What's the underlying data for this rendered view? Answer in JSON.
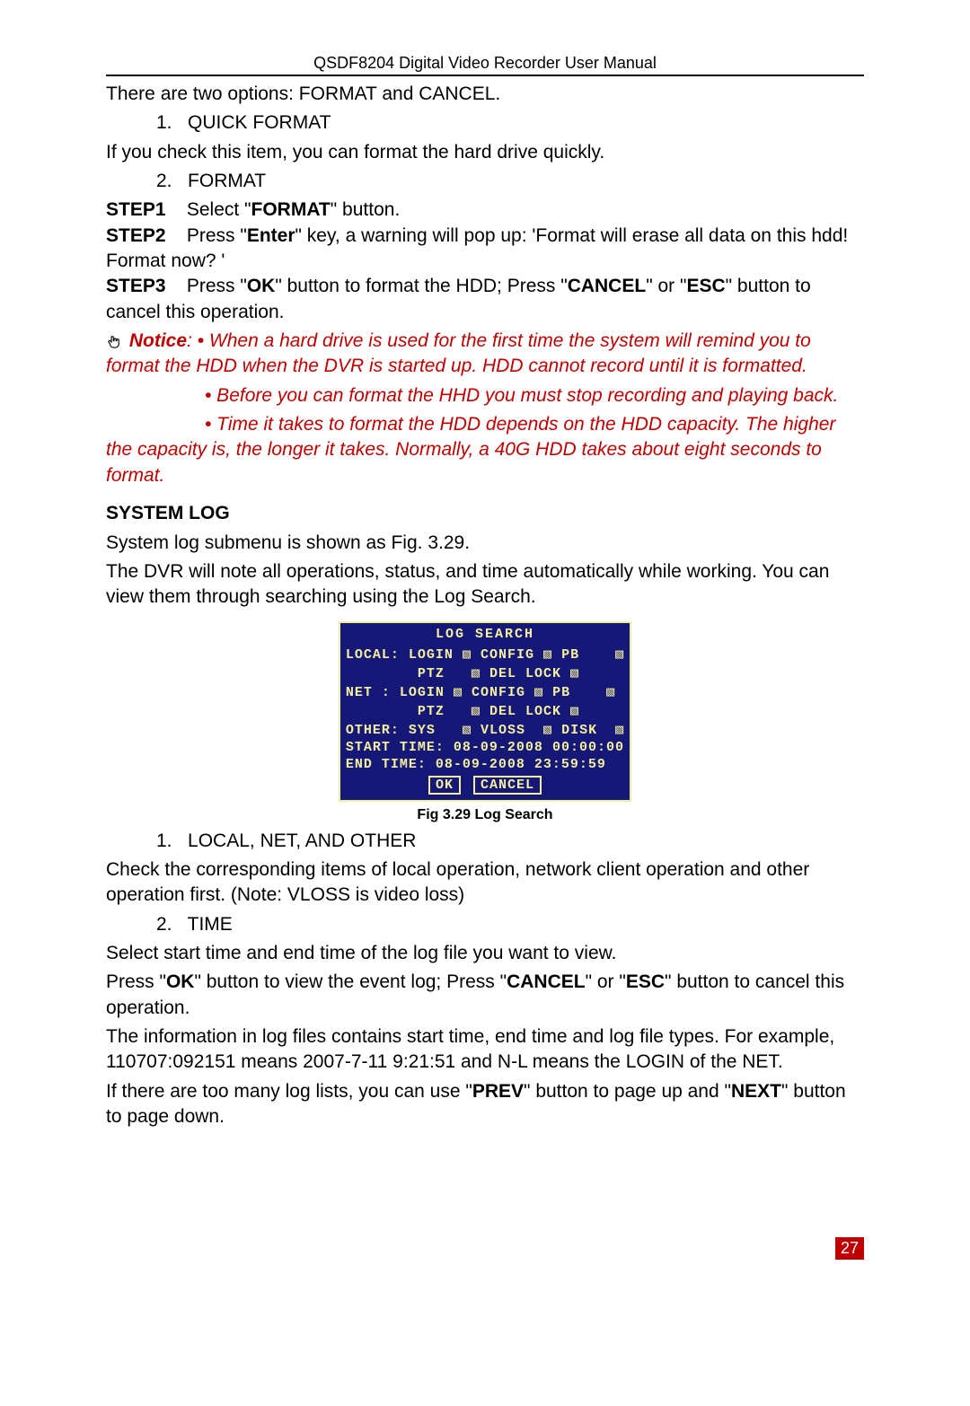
{
  "header": "QSDF8204 Digital Video Recorder User Manual",
  "intro": "There are two options: FORMAT and CANCEL.",
  "item1_num": "1.",
  "item1_label": "QUICK FORMAT",
  "item1_desc": "If you check this item, you can format the hard drive quickly.",
  "item2_num": "2.",
  "item2_label": "FORMAT",
  "step1_lbl": "STEP1",
  "step1_a": "Select \"",
  "step1_bold": "FORMAT",
  "step1_b": "\" button.",
  "step2_lbl": "STEP2",
  "step2_a": "Press \"",
  "step2_bold": "Enter",
  "step2_b": "\" key, a warning will pop up: 'Format will erase all data on this hdd!   Format now? '",
  "step3_lbl": "STEP3",
  "step3_a": "Press \"",
  "step3_bold1": "OK",
  "step3_b": "\" button to format the HDD; Press \"",
  "step3_bold2": "CANCEL",
  "step3_c": "\" or \"",
  "step3_bold3": "ESC",
  "step3_d": "\" button to cancel this operation.",
  "notice_label": "Notice",
  "notice_line1": ": • When a hard drive is used for the first time the system will remind you to format the HDD when the DVR is started up. HDD cannot record until it is formatted.",
  "notice_line2": "• Before you can format the HHD you must stop recording and playing back.",
  "notice_line3": "• Time it takes to format the HDD depends on the HDD capacity. The higher the capacity is, the longer it takes. Normally, a 40G HDD takes about eight seconds to format.",
  "syslog_heading": "SYSTEM LOG",
  "syslog_p1": "System log submenu is shown as Fig. 3.29.",
  "syslog_p2": "The DVR will note all operations, status, and time automatically while working. You can view them through searching using the Log Search.",
  "dvr": {
    "title": "LOG SEARCH",
    "row1": {
      "label": "LOCAL:",
      "c1": "LOGIN",
      "c2": "CONFIG",
      "c3": "PB"
    },
    "row2": {
      "label": "",
      "c1": "PTZ",
      "c2": "DEL LOCK"
    },
    "row3": {
      "label": "NET  :",
      "c1": "LOGIN",
      "c2": "CONFIG",
      "c3": "PB"
    },
    "row4": {
      "label": "",
      "c1": "PTZ",
      "c2": "DEL LOCK"
    },
    "row5": {
      "label": "OTHER:",
      "c1": "SYS",
      "c2": "VLOSS",
      "c3": "DISK"
    },
    "start_label": "START TIME:",
    "start_value": "08-09-2008 00:00:00",
    "end_label": "END   TIME:",
    "end_value": "08-09-2008 23:59:59",
    "ok": "OK",
    "cancel": "CANCEL"
  },
  "fig_caption": "Fig 3.29 Log Search",
  "log_item1_num": "1.",
  "log_item1_label": "LOCAL, NET, AND OTHER",
  "log_item1_desc": "Check the corresponding items of local operation, network client operation and other operation first. (Note: VLOSS is video loss)",
  "log_item2_num": "2.",
  "log_item2_label": "TIME",
  "log_item2_desc": "Select start time and end time of the log file you want to view.",
  "log_p3_a": "Press \"",
  "log_p3_b1": "OK",
  "log_p3_b": "\" button to view the event log; Press \"",
  "log_p3_b2": "CANCEL",
  "log_p3_c": "\" or \"",
  "log_p3_b3": "ESC",
  "log_p3_d": "\" button to cancel this operation.",
  "log_p4": "The information in log files contains start time, end time and log file types. For example, 110707:092151 means 2007-7-11 9:21:51 and N-L means the LOGIN of the NET.",
  "log_p5_a": "If there are too many log lists, you can use \"",
  "log_p5_b1": "PREV",
  "log_p5_b": "\" button to page up and \"",
  "log_p5_b2": "NEXT",
  "log_p5_c": "\" button to page down.",
  "page_number": "27"
}
